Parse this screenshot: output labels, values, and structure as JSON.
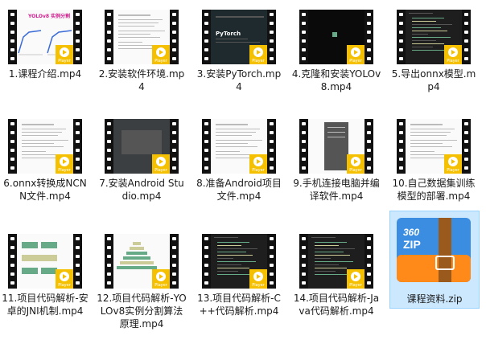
{
  "files": [
    {
      "name": "1.课程介绍.mp4",
      "thumb": "white-chart"
    },
    {
      "name": "2.安装软件环境.mp4",
      "thumb": "white-doc"
    },
    {
      "name": "3.安装PyTorch.mp4",
      "thumb": "dark-web"
    },
    {
      "name": "4.克隆和安装YOLOv8.mp4",
      "thumb": "black"
    },
    {
      "name": "5.导出onnx模型.mp4",
      "thumb": "dark-code"
    },
    {
      "name": "6.onnx转换成NCNN文件.mp4",
      "thumb": "white-doc"
    },
    {
      "name": "7.安装Android Studio.mp4",
      "thumb": "dark-ide"
    },
    {
      "name": "8.准备Android项目文件.mp4",
      "thumb": "white-doc"
    },
    {
      "name": "9.手机连接电脑并编译软件.mp4",
      "thumb": "white-phone"
    },
    {
      "name": "10.自己数据集训练模型的部署.mp4",
      "thumb": "white-doc"
    },
    {
      "name": "11.项目代码解析-安卓的JNI机制.mp4",
      "thumb": "white-diagram"
    },
    {
      "name": "12.项目代码解析-YOLOv8实例分割算法原理.mp4",
      "thumb": "white-pyramid"
    },
    {
      "name": "13.项目代码解析-C++代码解析.mp4",
      "thumb": "dark-code"
    },
    {
      "name": "14.项目代码解析-Java代码解析.mp4",
      "thumb": "dark-code"
    }
  ],
  "zip": {
    "name": "课程资料.zip",
    "brand": "360",
    "sub": "ZIP"
  },
  "player_badge": "Player",
  "thumb1_title": "YOLOv8 实例分割",
  "thumb3_title": "PyTorch",
  "colors": {
    "badge": "#f5c000",
    "zip_blue": "#3a8de0",
    "zip_orange": "#ff8a1a",
    "zip_strap": "#9a5a1e",
    "selection": "#cce8ff"
  }
}
